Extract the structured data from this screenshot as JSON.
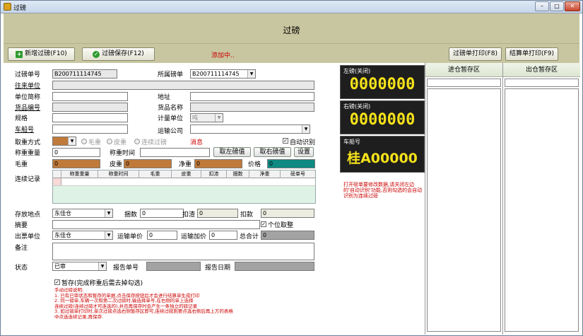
{
  "window": {
    "title": "过磅",
    "controls": {
      "minimize": "–",
      "maximize": "□",
      "close": "✕"
    }
  },
  "header": {
    "title": "过磅"
  },
  "toolbar": {
    "new_label": "新增过磅(F10)",
    "save_label": "过磅保存(F12)",
    "status": "添加中..",
    "print_weigh_label": "过磅单打印(F8)",
    "print_settle_label": "结算单打印(F9)",
    "colors": {
      "new_icon": "#2e9a2e",
      "save_icon": "#2e9a2e",
      "status": "#c00000"
    }
  },
  "form": {
    "weigh_no": {
      "label": "过磅单号",
      "value": "B200711114745"
    },
    "belong_no": {
      "label": "所属磅单",
      "value": "B200711114745"
    },
    "partner": {
      "label": "往来单位",
      "value": ""
    },
    "unit_short": {
      "label": "单位简称",
      "value": ""
    },
    "address": {
      "label": "地址",
      "value": ""
    },
    "goods_code": {
      "label": "货品编号",
      "value": ""
    },
    "goods_name": {
      "label": "货品名称",
      "value": ""
    },
    "spec": {
      "label": "规格",
      "value": ""
    },
    "unit": {
      "label": "计量单位",
      "value": "吨"
    },
    "vehicle_no": {
      "label": "车船号",
      "value": ""
    },
    "transport_co": {
      "label": "运输公司",
      "value": ""
    },
    "weigh_mode": {
      "label": "取重方式",
      "value": "",
      "options": [
        "毛重",
        "皮重",
        "连续过磅"
      ]
    },
    "message_label": "消息",
    "auto_detect": {
      "label": "自动识别",
      "checked": true
    },
    "weight": {
      "label": "称重重量",
      "value": "0"
    },
    "weigh_time": {
      "label": "称重时间",
      "value": ""
    },
    "get_left": "取左磅值",
    "get_right": "取右磅值",
    "settings": "设置",
    "gross": {
      "label": "毛重",
      "value": "0"
    },
    "tare": {
      "label": "皮重",
      "value": "0"
    },
    "net": {
      "label": "净重",
      "value": "0"
    },
    "price": {
      "label": "价格",
      "value": "0"
    },
    "continuous": {
      "label": "连续记录",
      "columns": [
        "称重重量",
        "称重时间",
        "毛重",
        "皮重",
        "扣渣",
        "捆数",
        "净重",
        "磅单号"
      ]
    },
    "location": {
      "label": "存放地点",
      "value": "东佳仓"
    },
    "bundles": {
      "label": "捆数",
      "value": "0"
    },
    "deduct_slag": {
      "label": "扣渣",
      "value": "0"
    },
    "deduct_amt": {
      "label": "扣款",
      "value": "0"
    },
    "summary": {
      "label": "摘要",
      "value": ""
    },
    "single_deduct": {
      "label": "个位取整",
      "checked": true
    },
    "issue_unit": {
      "label": "出票单位",
      "value": "东佳仓"
    },
    "freight": {
      "label": "运输单价",
      "value": "0"
    },
    "freight_add": {
      "label": "运输加价",
      "value": "0"
    },
    "total": {
      "label": "总合计",
      "value": "0"
    },
    "remark": {
      "label": "备注",
      "value": ""
    },
    "state": {
      "label": "状态",
      "value": "已审"
    },
    "report_no": {
      "label": "报告单号",
      "value": ""
    },
    "report_date": {
      "label": "报告日期",
      "value": ""
    },
    "temp_save": {
      "label": "暂存(完成称重后需去掉勾选)",
      "checked": true
    },
    "notes": [
      "手动过磅说明:",
      "1. 已有已审状态和暂存的单据,点击保存按钮后才会进行结算单生成打印",
      "2. 同一磅单,车辆一次和第二次过磅时,输选择单号,在右侧的单上选择",
      "连续过磅(连续过磅才可连选的),并且再保存时会产生一条独立的磅记录",
      "3. 如过磅单打印时,单次过磅点选右侧暂存区即可,连续过磅则要点选右侧后再上方的表格",
      "中点选连续记录,再保存."
    ]
  },
  "scale": {
    "left": {
      "label": "左磅(关闭)",
      "value": "0000000"
    },
    "right": {
      "label": "右磅(关闭)",
      "value": "0000000"
    },
    "vehicle": {
      "label": "车船号",
      "value": "桂A00000"
    },
    "note": "打开磅单要修改数据,请关闭左边的'自动识别'功能,否则勾选的会自动识别为连续过磅",
    "colors": {
      "display_bg": "#1e1e1e",
      "digits": "#f5e21a",
      "note": "#c00000"
    }
  },
  "storage": {
    "in_label": "进仓暂存区",
    "out_label": "出仓暂存区"
  },
  "colors": {
    "header_bg": "#c8c6a0",
    "orange_field": "#c07a3a",
    "teal_field": "#0e8a82",
    "grid_bg": "#dff2e6"
  }
}
